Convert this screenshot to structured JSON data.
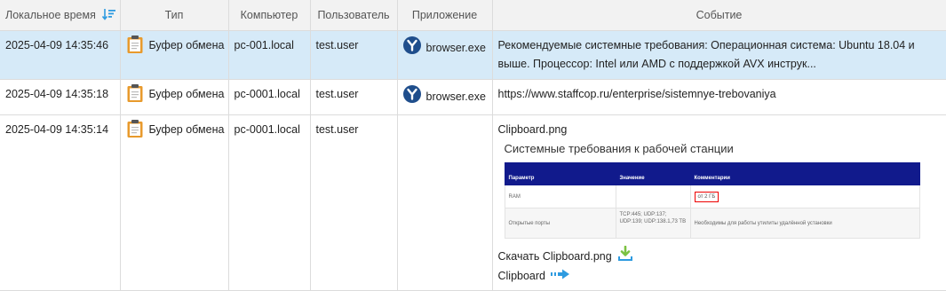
{
  "columns": {
    "time": "Локальное время",
    "type": "Тип",
    "computer": "Компьютер",
    "user": "Пользователь",
    "app": "Приложение",
    "event": "Событие"
  },
  "rows": [
    {
      "time": "2025-04-09 14:35:46",
      "type": "Буфер обмена",
      "computer": "pc-001.local",
      "user": "test.user",
      "app": "browser.exe",
      "event": "Рекомендуемые системные требования: Операционная система: Ubuntu 18.04 и выше. Процессор: Intel или AMD с поддержкой AVX инструк..."
    },
    {
      "time": "2025-04-09 14:35:18",
      "type": "Буфер обмена",
      "computer": "pc-0001.local",
      "user": "test.user",
      "app": "browser.exe",
      "event": "https://www.staffcop.ru/enterprise/sistemnye-trebovaniya"
    },
    {
      "time": "2025-04-09 14:35:14",
      "type": "Буфер обмена",
      "computer": "pc-0001.local",
      "user": "test.user",
      "app": "",
      "event": "Clipboard.png",
      "screenshot": {
        "title": "Системные требования к рабочей станции",
        "headers": [
          "Параметр",
          "Значение",
          "Комментарии"
        ],
        "rows": [
          [
            "RAM",
            "",
            "от 2 ГБ"
          ],
          [
            "Открытые порты",
            "TCP:445; UDP:137; UDP:139; UDP:138.1,73 TB",
            "Необходимы для работы утилиты удалённой установки"
          ]
        ]
      },
      "download_label": "Скачать Clipboard.png",
      "clipboard_label": "Clipboard"
    }
  ],
  "colors": {
    "selected_row": "#d6eaf8",
    "header_bg": "#f2f2f2",
    "app_icon": "#1f4e8c",
    "clip_icon": "#e89a2c",
    "download_icon": "#7cc242",
    "arrow_icon": "#2e9be0",
    "mini_header": "#111a8c",
    "highlight": "#e00000"
  }
}
